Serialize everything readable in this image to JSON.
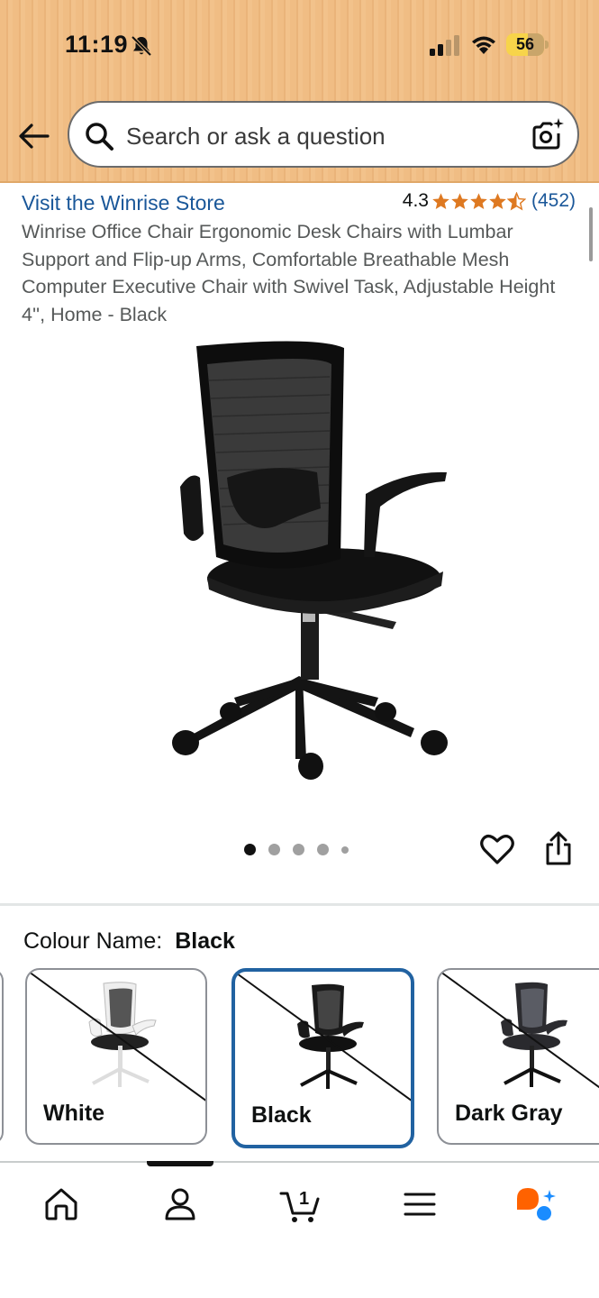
{
  "status_bar": {
    "time": "11:19",
    "battery": "56",
    "icons": [
      "bell-muted-icon",
      "signal-icon",
      "wifi-icon",
      "battery-icon"
    ]
  },
  "header": {
    "search_placeholder": "Search or ask a question",
    "icons": [
      "back-arrow-icon",
      "search-icon",
      "camera-search-icon"
    ]
  },
  "product": {
    "store_link": "Visit the Winrise Store",
    "rating": "4.3",
    "stars": 4.3,
    "review_count": "(452)",
    "title": "Winrise Office Chair Ergonomic Desk Chairs with Lumbar Support and Flip-up Arms, Comfortable Breathable Mesh Computer Executive Chair with Swivel Task, Adjustable Height 4'', Home - Black",
    "image_count": 5,
    "active_image": 1
  },
  "colour": {
    "label": "Colour Name:",
    "selected": "Black",
    "options": [
      {
        "label": "White",
        "available": false
      },
      {
        "label": "Black",
        "available": false,
        "selected": true
      },
      {
        "label": "Dark Gray",
        "available": false
      }
    ]
  },
  "bottom_nav": {
    "items": [
      "home-icon",
      "account-icon",
      "cart-icon",
      "menu-icon",
      "rufus-assistant-icon"
    ],
    "cart_count": "1",
    "active": "account-icon"
  },
  "colors": {
    "link": "#1a5799",
    "star": "#de7921",
    "selected_border": "#2162a1",
    "header_bg": "#f0bd84"
  }
}
